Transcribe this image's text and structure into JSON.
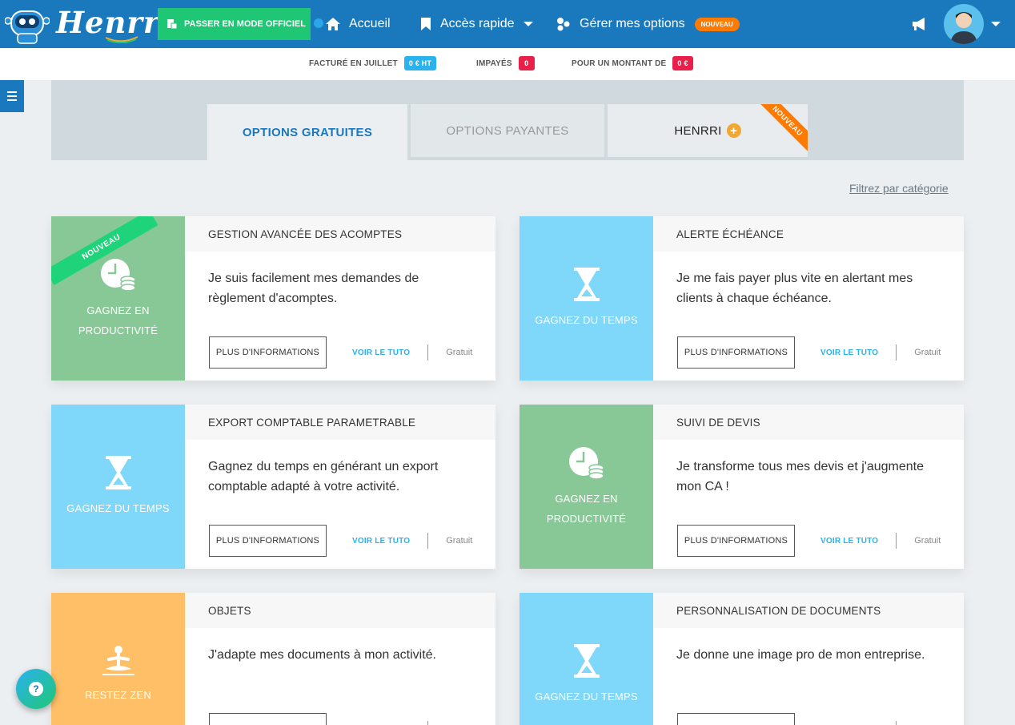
{
  "topbar": {
    "brand": "Henrri",
    "official_mode_label": "PASSER EN MODE OFFICIEL",
    "nav": {
      "home": "Accueil",
      "quick_access": "Accès rapide",
      "manage_options": "Gérer mes options",
      "new_badge": "NOUVEAU"
    }
  },
  "stats": {
    "invoiced_label": "FACTURÉ EN JUILLET",
    "invoiced_value": "0 € HT",
    "unpaid_label": "IMPAYÉS",
    "unpaid_value": "0",
    "amount_label": "POUR UN MONTANT DE",
    "amount_value": "0 €"
  },
  "tabs": {
    "free": "OPTIONS GRATUITES",
    "paid": "OPTIONS PAYANTES",
    "henrri_plus": "HENRRI",
    "henrri_plus_ribbon": "NOUVEAU"
  },
  "filter_label": "Filtrez par catégorie",
  "common": {
    "more_info": "PLUS D'INFORMATIONS",
    "tutorial": "VOIR LE TUTO",
    "price": "Gratuit"
  },
  "cards": [
    {
      "title": "GESTION AVANCÉE DES ACOMPTES",
      "description": "Je suis facilement mes demandes de règlement d'acomptes.",
      "category_line1": "GAGNEZ EN",
      "category_line2": "PRODUCTIVITÉ",
      "ribbon": "NOUVEAU",
      "icon": "clock-coins-icon",
      "color": "#88c897"
    },
    {
      "title": "ALERTE ÉCHÉANCE",
      "description": "Je me fais payer plus vite en alertant mes clients à chaque échéance.",
      "category_line1": "GAGNEZ DU TEMPS",
      "icon": "hourglass-icon",
      "color": "#7fd7f9"
    },
    {
      "title": "EXPORT COMPTABLE PARAMETRABLE",
      "description": "Gagnez du temps en générant un export comptable adapté à votre activité.",
      "category_line1": "GAGNEZ DU TEMPS",
      "icon": "hourglass-icon",
      "color": "#7fd7f9"
    },
    {
      "title": "SUIVI DE DEVIS",
      "description": "Je transforme tous mes devis et j'augmente mon CA !",
      "category_line1": "GAGNEZ EN",
      "category_line2": "PRODUCTIVITÉ",
      "icon": "clock-coins-icon",
      "color": "#88c897"
    },
    {
      "title": "OBJETS",
      "description": "J'adapte mes documents à mon activité.",
      "category_line1": "RESTEZ ZEN",
      "icon": "meditation-icon",
      "color": "#ffbf66"
    },
    {
      "title": "PERSONNALISATION DE DOCUMENTS",
      "description": "Je donne une image pro de mon entreprise.",
      "category_line1": "GAGNEZ DU TEMPS",
      "icon": "hourglass-icon",
      "color": "#7fd7f9"
    }
  ],
  "help_label": "?"
}
